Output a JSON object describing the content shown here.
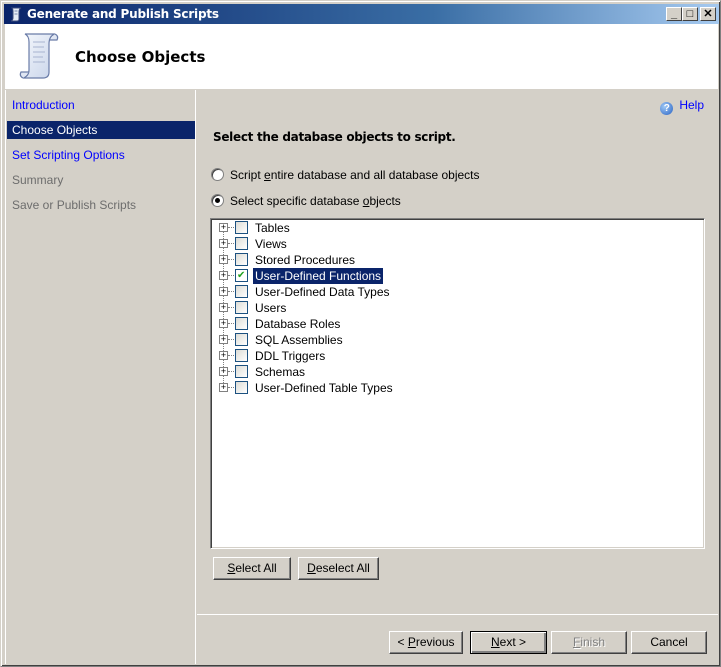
{
  "window": {
    "title": "Generate and Publish Scripts",
    "controls": {
      "minimize": "_",
      "maximize": "□",
      "close": "✕"
    }
  },
  "header": {
    "page_title": "Choose Objects",
    "icon": "script-scroll-icon"
  },
  "sidebar": {
    "items": [
      {
        "label": "Introduction",
        "state": "link"
      },
      {
        "label": "Choose Objects",
        "state": "active"
      },
      {
        "label": "Set Scripting Options",
        "state": "link"
      },
      {
        "label": "Summary",
        "state": "disabled"
      },
      {
        "label": "Save or Publish Scripts",
        "state": "disabled"
      }
    ]
  },
  "main": {
    "help_label": "Help",
    "instruction": "Select the database objects to script.",
    "radio_options": [
      {
        "label_pre": "Script ",
        "accel": "e",
        "label_post": "ntire database and all database objects",
        "checked": false
      },
      {
        "label_pre": "Select specific database ",
        "accel": "o",
        "label_post": "bjects",
        "checked": true
      }
    ],
    "tree_items": [
      {
        "label": "Tables",
        "checked": false,
        "selected": false
      },
      {
        "label": "Views",
        "checked": false,
        "selected": false
      },
      {
        "label": "Stored Procedures",
        "checked": false,
        "selected": false
      },
      {
        "label": "User-Defined Functions",
        "checked": true,
        "selected": true
      },
      {
        "label": "User-Defined Data Types",
        "checked": false,
        "selected": false
      },
      {
        "label": "Users",
        "checked": false,
        "selected": false
      },
      {
        "label": "Database Roles",
        "checked": false,
        "selected": false
      },
      {
        "label": "SQL Assemblies",
        "checked": false,
        "selected": false
      },
      {
        "label": "DDL Triggers",
        "checked": false,
        "selected": false
      },
      {
        "label": "Schemas",
        "checked": false,
        "selected": false
      },
      {
        "label": "User-Defined Table Types",
        "checked": false,
        "selected": false
      }
    ],
    "select_all": {
      "accel": "S",
      "rest": "elect All"
    },
    "deselect_all": {
      "accel": "D",
      "rest": "eselect All"
    }
  },
  "footer": {
    "previous": {
      "pre": "< ",
      "accel": "P",
      "rest": "revious"
    },
    "next": {
      "pre": "",
      "accel": "N",
      "rest": "ext >"
    },
    "finish": {
      "pre": "",
      "accel": "F",
      "rest": "inish",
      "disabled": true
    },
    "cancel": "Cancel"
  }
}
